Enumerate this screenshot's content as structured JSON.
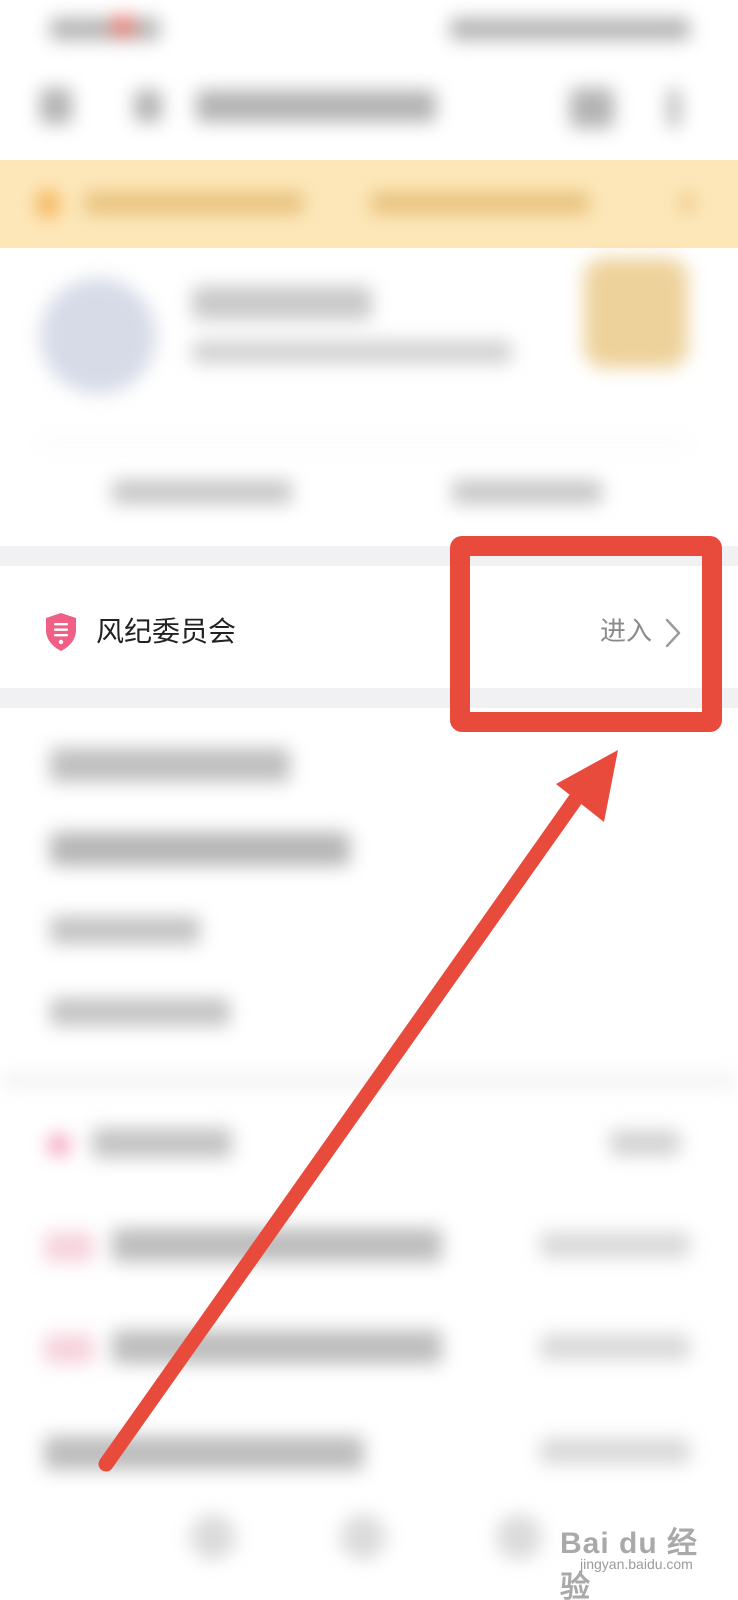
{
  "committee": {
    "title": "风纪委员会",
    "enter_label": "进入"
  },
  "watermark": {
    "brand": "Bai du 经验",
    "url": "jingyan.baidu.com"
  },
  "colors": {
    "highlight": "#e84a3c",
    "shield": "#ef5f86",
    "banner": "#fde7b9"
  },
  "icons": {
    "shield": "shield-icon",
    "chevron": "chevron-right-icon",
    "arrow": "annotation-arrow"
  }
}
